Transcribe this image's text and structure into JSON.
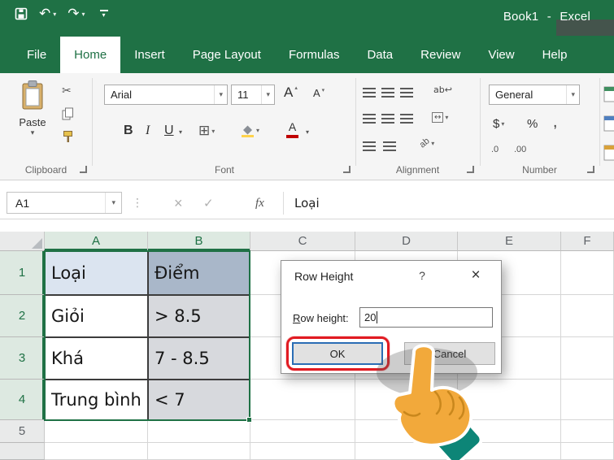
{
  "titlebar": {
    "workbook": "Book1",
    "separator": "-",
    "app": "Excel"
  },
  "icons": {
    "undo": "↶",
    "redo": "↷",
    "dropdown": "▾",
    "up_arrow": "▴",
    "cut": "✂",
    "checkmark": "✓",
    "cancel_x": "×",
    "ellipsis": "⋮",
    "borders": "⊞",
    "merge_arrows": "↔",
    "wrap_text": "ab↩",
    "orientation": "ab"
  },
  "tabs": {
    "file": "File",
    "home": "Home",
    "insert": "Insert",
    "page_layout": "Page Layout",
    "formulas": "Formulas",
    "data": "Data",
    "review": "Review",
    "view": "View",
    "help": "Help"
  },
  "ribbon": {
    "paste": "Paste",
    "font_name": "Arial",
    "font_size": "11",
    "bold": "B",
    "italic": "I",
    "underline": "U",
    "grow_font": "A",
    "shrink_font": "A",
    "font_color_letter": "A",
    "number_format": "General",
    "currency": "$",
    "percent": "%",
    "comma": ",",
    "inc_decimal": ".0",
    "dec_decimal": ".00",
    "groups": {
      "clipboard": "Clipboard",
      "font": "Font",
      "alignment": "Alignment",
      "number": "Number"
    }
  },
  "formula_bar": {
    "name_box": "A1",
    "fx": "fx",
    "value": "Loại"
  },
  "grid": {
    "columns": [
      "A",
      "B",
      "C",
      "D",
      "E",
      "F"
    ],
    "rows": [
      "1",
      "2",
      "3",
      "4",
      "5"
    ],
    "cells": {
      "a1": "Loại",
      "b1": "Điểm",
      "a2": "Giỏi",
      "b2": "> 8.5",
      "a3": "Khá",
      "b3": "7 - 8.5",
      "a4": "Trung bình",
      "b4": "< 7"
    }
  },
  "dialog": {
    "title": "Row Height",
    "help": "?",
    "close": "×",
    "label_accesskey": "R",
    "label_rest": "ow height:",
    "value": "20",
    "ok": "OK",
    "cancel": "Cancel"
  },
  "colors": {
    "excel_green": "#1f7145",
    "annotation_red": "#e11b22",
    "hand_orange": "#f2a93b",
    "cuff_teal": "#0d8577"
  }
}
